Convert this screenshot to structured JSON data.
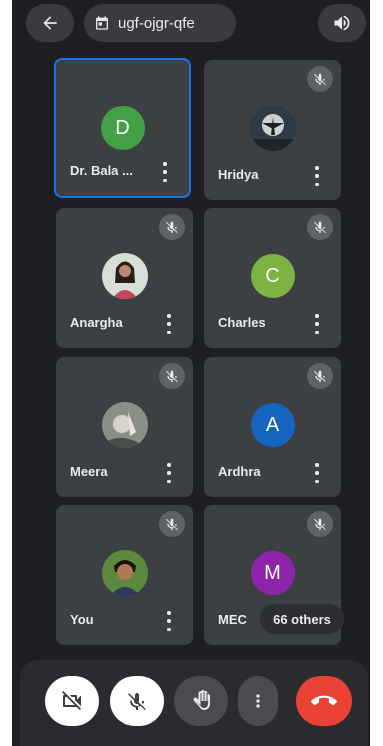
{
  "header": {
    "back_icon": "arrow-left-icon",
    "meeting_code": "ugf-ojgr-qfe",
    "calendar_icon": "calendar-icon",
    "speaker_icon": "speaker-icon"
  },
  "tiles": [
    {
      "name": "Dr. Bala ...",
      "initial": "D",
      "avatar_color": "#43a047",
      "muted": false,
      "active": true
    },
    {
      "name": "Hridya",
      "photo": "person-photo",
      "muted": true
    },
    {
      "name": "Anargha",
      "photo": "person-photo",
      "muted": true
    },
    {
      "name": "Charles",
      "initial": "C",
      "avatar_color": "#7cb342",
      "muted": true
    },
    {
      "name": "Meera",
      "photo": "person-photo",
      "muted": true
    },
    {
      "name": "Ardhra",
      "initial": "A",
      "avatar_color": "#1565c0",
      "muted": true
    },
    {
      "name": "You",
      "photo": "person-photo",
      "muted": true
    },
    {
      "name": "MEC",
      "initial": "M",
      "avatar_color": "#8e24aa",
      "muted": true
    }
  ],
  "others_label": "66 others",
  "controls": {
    "camera_icon": "camera-off-icon",
    "mic_icon": "mic-off-icon",
    "hand_icon": "raise-hand-icon",
    "more_icon": "more-vertical-icon",
    "end_icon": "end-call-icon"
  },
  "colors": {
    "background": "#1e1f22",
    "tile": "#3c4043",
    "active_border": "#1a73e8",
    "end_call": "#ea4335"
  }
}
